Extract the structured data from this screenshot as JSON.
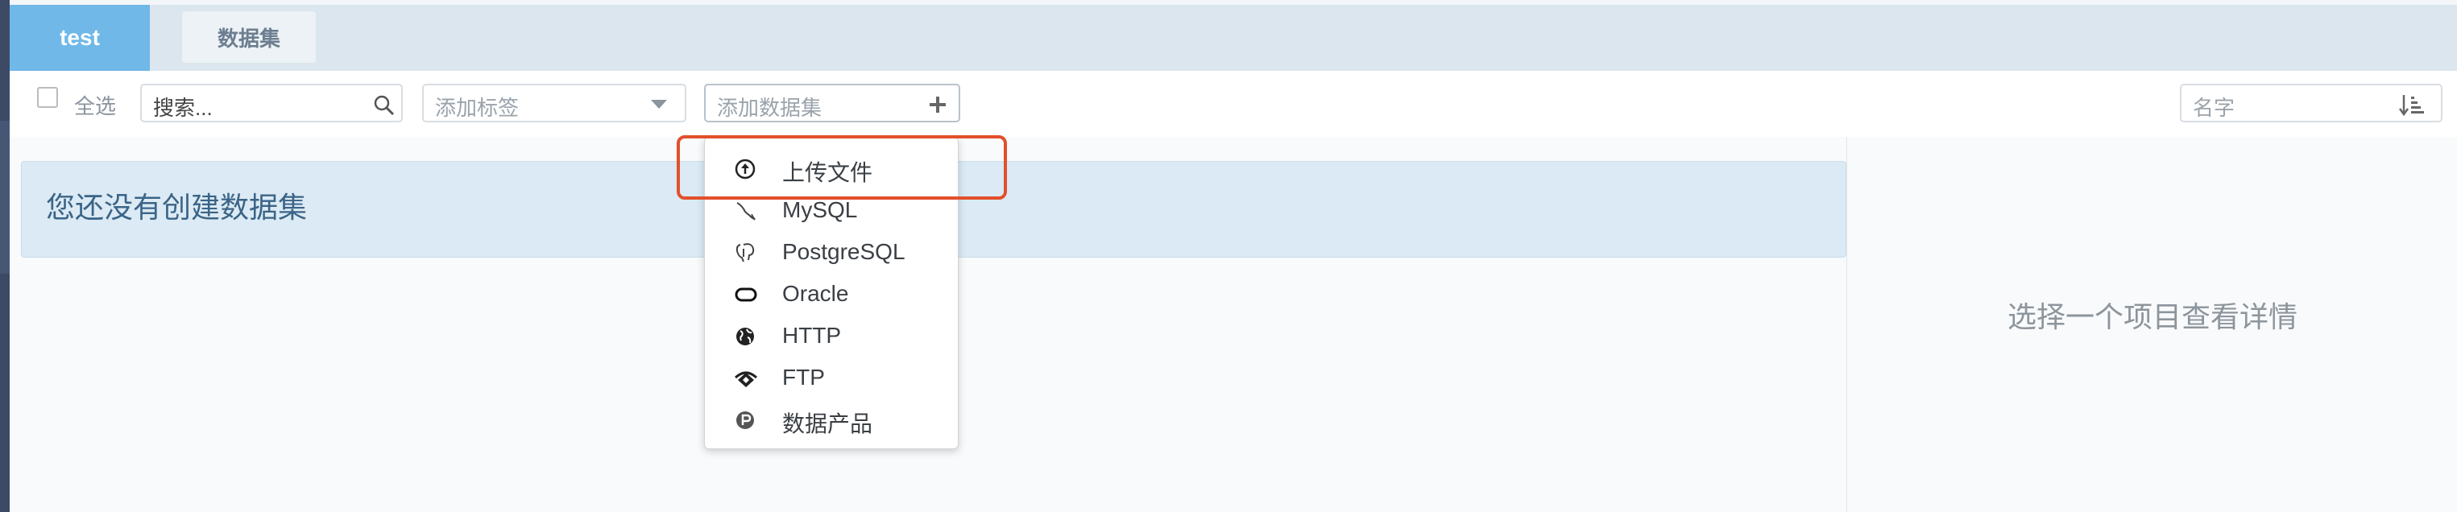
{
  "tabs": {
    "active": "test",
    "second": "数据集"
  },
  "toolbar": {
    "select_all": "全选",
    "search_value": "搜索...",
    "tag_placeholder": "添加标签",
    "add_dataset": "添加数据集",
    "sort_placeholder": "名字"
  },
  "main": {
    "empty_message": "您还没有创建数据集"
  },
  "detail": {
    "placeholder": "选择一个项目查看详情"
  },
  "menu": {
    "items": [
      {
        "label": "上传文件",
        "icon": "upload-icon"
      },
      {
        "label": "MySQL",
        "icon": "mysql-icon"
      },
      {
        "label": "PostgreSQL",
        "icon": "postgresql-icon"
      },
      {
        "label": "Oracle",
        "icon": "oracle-icon"
      },
      {
        "label": "HTTP",
        "icon": "globe-icon"
      },
      {
        "label": "FTP",
        "icon": "ftp-icon"
      },
      {
        "label": "数据产品",
        "icon": "data-product-icon"
      }
    ]
  },
  "colors": {
    "highlight": "#e2502b",
    "active_tab": "#6fb8e8",
    "banner": "#dbeaf4"
  }
}
